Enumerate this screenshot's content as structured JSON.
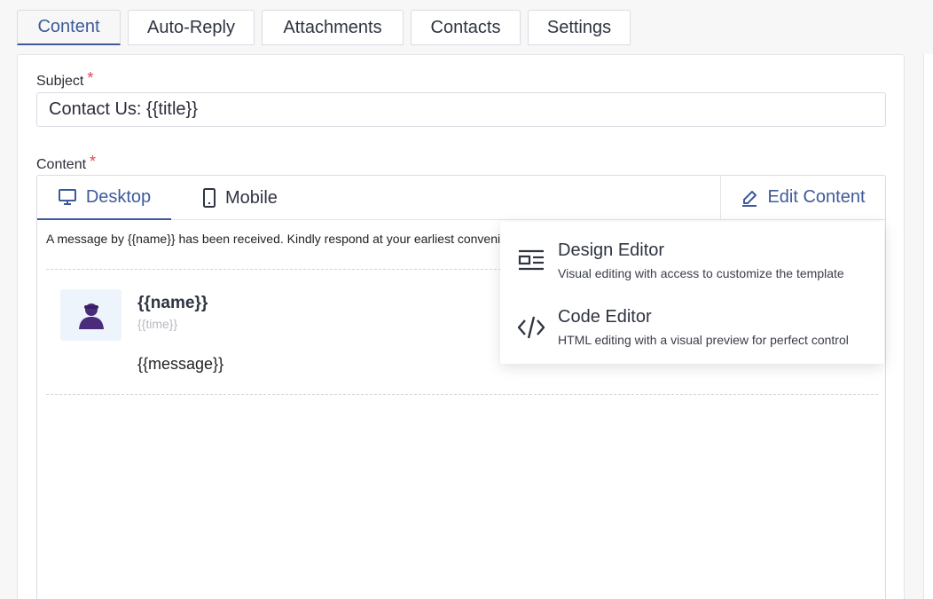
{
  "tabs": [
    {
      "label": "Content",
      "active": true
    },
    {
      "label": "Auto-Reply"
    },
    {
      "label": "Attachments"
    },
    {
      "label": "Contacts"
    },
    {
      "label": "Settings"
    }
  ],
  "form": {
    "subject_label": "Subject",
    "subject_value": "Contact Us: {{title}}",
    "content_label": "Content",
    "required_mark": "*"
  },
  "editor": {
    "desktop_label": "Desktop",
    "mobile_label": "Mobile",
    "edit_label": "Edit Content",
    "intro_text": "A message by {{name}} has been received. Kindly respond at your earliest convenience.",
    "name": "{{name}}",
    "time": "{{time}}",
    "message": "{{message}}"
  },
  "dropdown": {
    "items": [
      {
        "title": "Design Editor",
        "description": "Visual editing with access to customize the template",
        "icon": "layout-icon"
      },
      {
        "title": "Code Editor",
        "description": "HTML editing with a visual preview for perfect control",
        "icon": "code-icon"
      }
    ]
  },
  "colors": {
    "accent": "#3e5a9a",
    "required": "#e0445a",
    "avatar": "#4a2c7a"
  }
}
